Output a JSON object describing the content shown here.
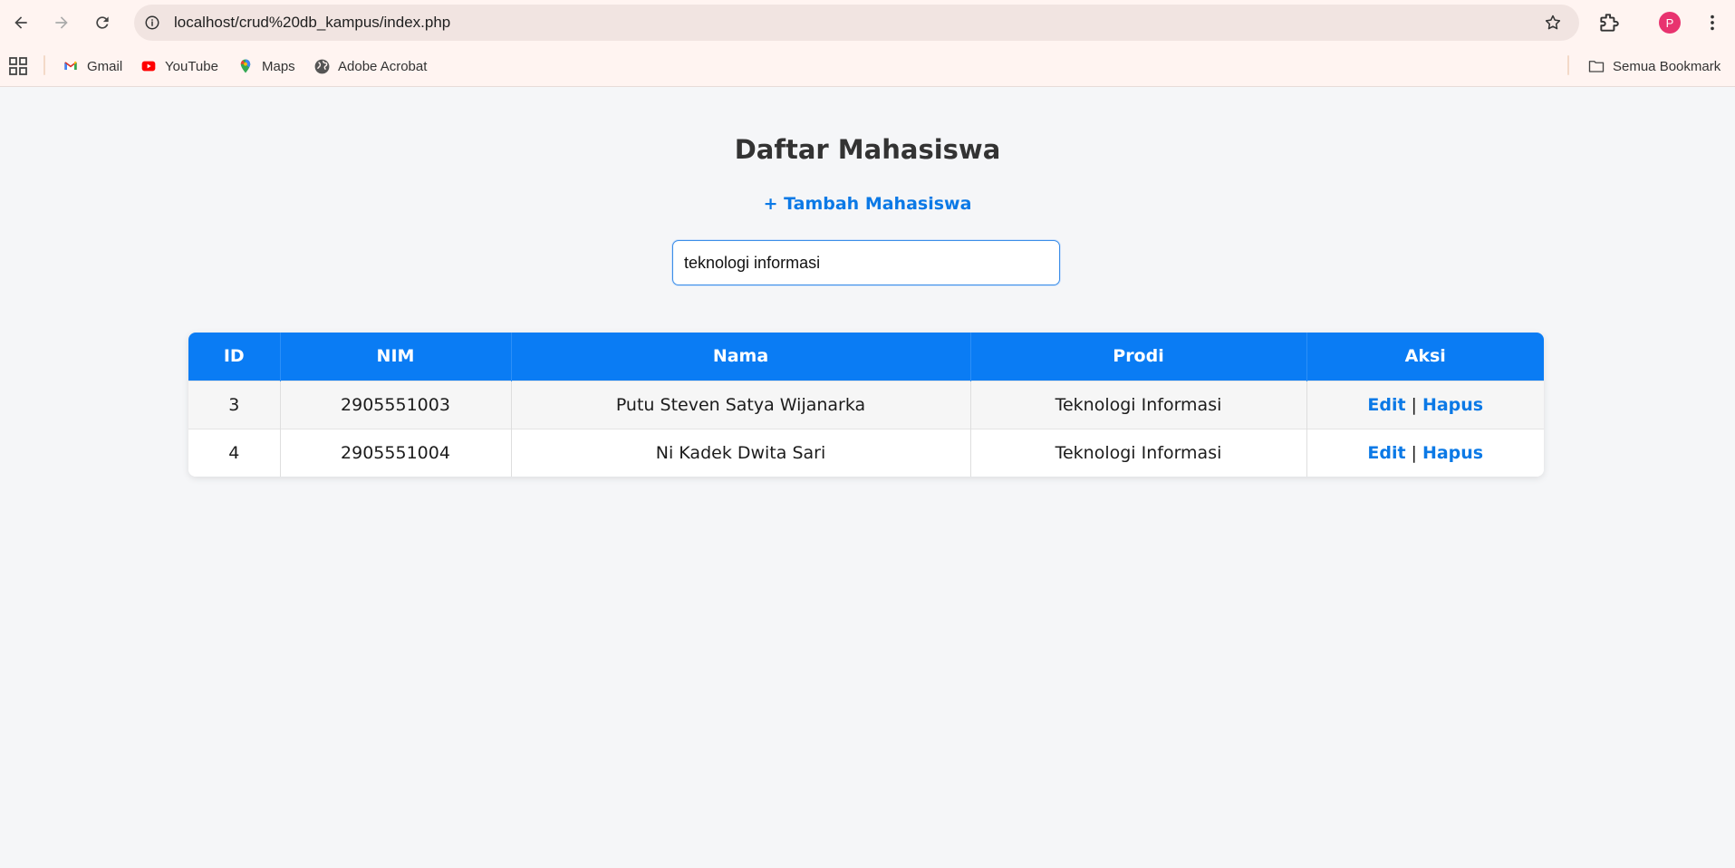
{
  "browser": {
    "url": "localhost/crud%20db_kampus/index.php",
    "profile_initial": "P",
    "bookmarks": [
      {
        "label": "Gmail",
        "icon": "gmail-icon"
      },
      {
        "label": "YouTube",
        "icon": "youtube-icon"
      },
      {
        "label": "Maps",
        "icon": "maps-icon"
      },
      {
        "label": "Adobe Acrobat",
        "icon": "globe-icon"
      }
    ],
    "all_bookmarks_label": "Semua Bookmark"
  },
  "page": {
    "title": "Daftar Mahasiswa",
    "add_link": "+ Tambah Mahasiswa",
    "search_value": "teknologi informasi"
  },
  "table": {
    "headers": [
      "ID",
      "NIM",
      "Nama",
      "Prodi",
      "Aksi"
    ],
    "rows": [
      {
        "id": "3",
        "nim": "2905551003",
        "nama": "Putu Steven Satya Wijanarka",
        "prodi": "Teknologi Informasi",
        "edit": "Edit",
        "sep": "|",
        "hapus": "Hapus"
      },
      {
        "id": "4",
        "nim": "2905551004",
        "nama": "Ni Kadek Dwita Sari",
        "prodi": "Teknologi Informasi",
        "edit": "Edit",
        "sep": "|",
        "hapus": "Hapus"
      }
    ]
  },
  "colors": {
    "accent": "#0a7cf4",
    "link": "#0b79e6",
    "background": "#f5f6f8",
    "chrome": "#fff4f1"
  }
}
